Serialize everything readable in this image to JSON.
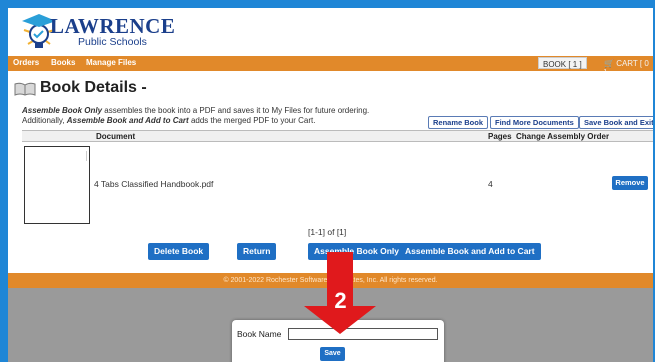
{
  "app": {
    "logo_title": "LAWRENCE",
    "logo_subtitle": "Public Schools"
  },
  "nav": {
    "items": [
      "Orders",
      "Books",
      "Manage Files"
    ],
    "book_badge": "BOOK [ 1 ]",
    "cart_badge": "CART [ 0 ]"
  },
  "page": {
    "title": "Book Details -",
    "desc_line1_bold": "Assemble Book Only",
    "desc_line1_rest": " assembles the book into a PDF and saves it to My Files for future ordering.",
    "desc_line2_pre": "Additionally, ",
    "desc_line2_bold": "Assemble Book and Add to Cart",
    "desc_line2_rest": " adds the merged PDF to your Cart."
  },
  "actions": {
    "rename": "Rename Book",
    "find_more": "Find More Documents",
    "save_exit": "Save Book and Exit"
  },
  "table": {
    "headers": {
      "document": "Document",
      "pages": "Pages",
      "order": "Change Assembly Order"
    },
    "rows": [
      {
        "name": "4 Tabs Classified Handbook.pdf",
        "pages": "4",
        "action": "Remove"
      }
    ]
  },
  "pager": "[1-1] of [1]",
  "buttons": {
    "delete": "Delete Book",
    "return": "Return",
    "assemble_only": "Assemble Book Only",
    "assemble_cart": "Assemble Book and Add to Cart"
  },
  "footer": "© 2001-2022 Rochester Software Associates, Inc. All rights reserved.",
  "modal": {
    "label": "Book Name",
    "value": "",
    "save": "Save"
  },
  "annotation": {
    "step": "2"
  },
  "colors": {
    "outer_border": "#1f86d6",
    "nav_orange": "#e1892a",
    "button_blue": "#1f6fc4",
    "arrow_red": "#e0191c",
    "brand_navy": "#1b3f8b"
  }
}
